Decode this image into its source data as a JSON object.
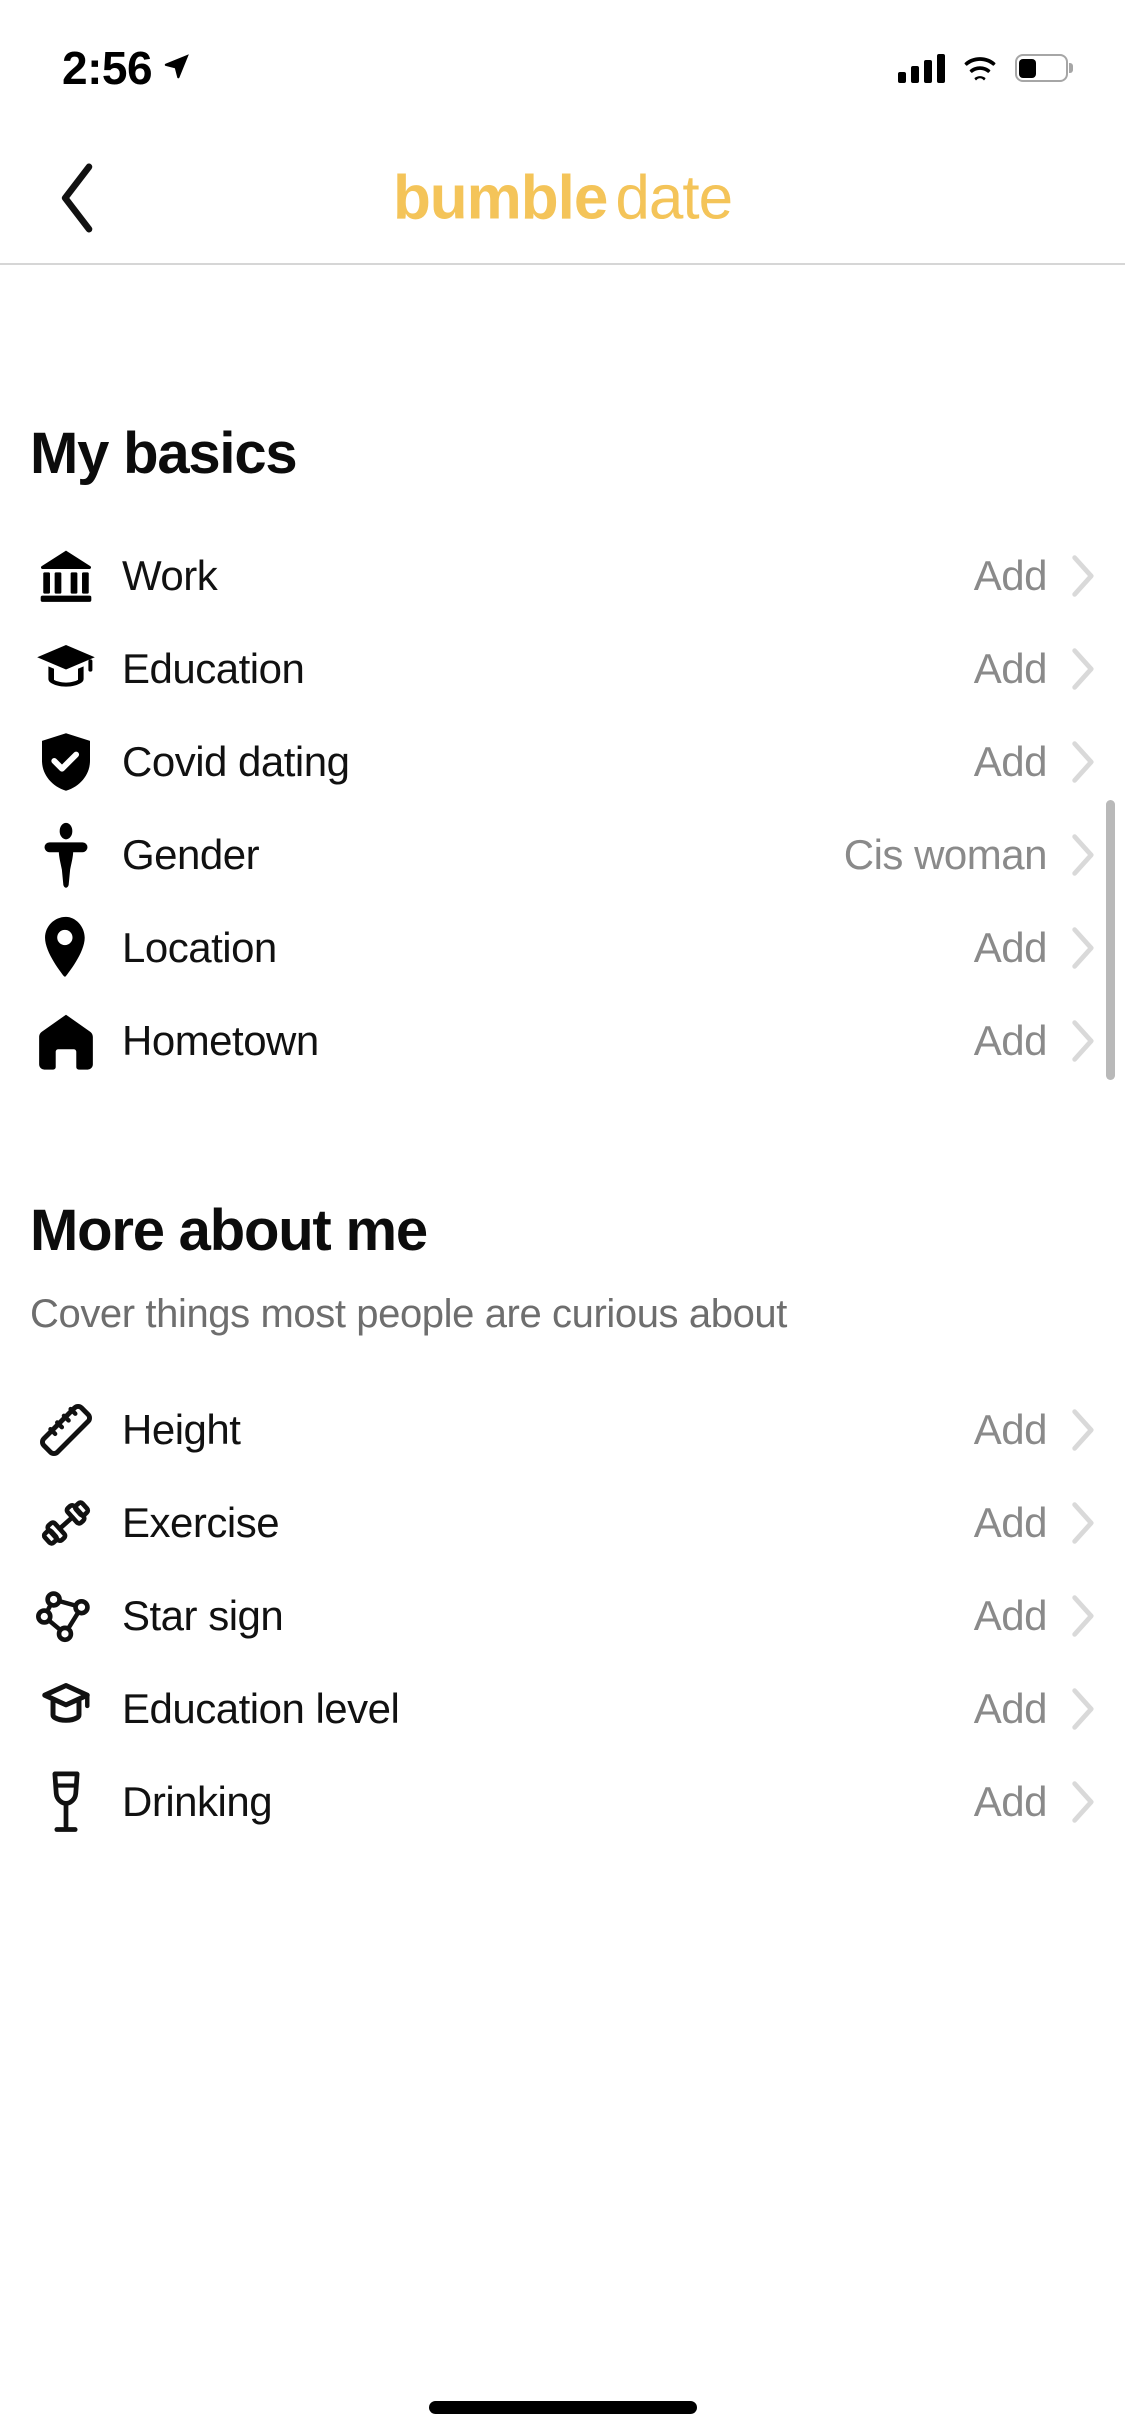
{
  "status_bar": {
    "time": "2:56",
    "location_icon": "location-arrow-icon",
    "cellular_icon": "cellular-signal-icon",
    "cellular_bars": 4,
    "wifi_icon": "wifi-icon",
    "battery_icon": "battery-icon",
    "battery_level_percent": 30
  },
  "navbar": {
    "back_icon": "chevron-left-icon",
    "brand_primary": "bumble",
    "brand_secondary": "date",
    "brand_color": "#F4C459"
  },
  "sections": [
    {
      "title": "My basics",
      "subtitle": "",
      "rows": [
        {
          "icon": "bank-icon",
          "label": "Work",
          "value": "Add",
          "chevron": "chevron-right-icon"
        },
        {
          "icon": "graduation-cap-filled-icon",
          "label": "Education",
          "value": "Add",
          "chevron": "chevron-right-icon"
        },
        {
          "icon": "shield-check-icon",
          "label": "Covid dating",
          "value": "Add",
          "chevron": "chevron-right-icon"
        },
        {
          "icon": "person-icon",
          "label": "Gender",
          "value": "Cis woman",
          "chevron": "chevron-right-icon"
        },
        {
          "icon": "map-pin-icon",
          "label": "Location",
          "value": "Add",
          "chevron": "chevron-right-icon"
        },
        {
          "icon": "house-icon",
          "label": "Hometown",
          "value": "Add",
          "chevron": "chevron-right-icon"
        }
      ]
    },
    {
      "title": "More about me",
      "subtitle": "Cover things most people are curious about",
      "rows": [
        {
          "icon": "ruler-icon",
          "label": "Height",
          "value": "Add",
          "chevron": "chevron-right-icon"
        },
        {
          "icon": "dumbbell-icon",
          "label": "Exercise",
          "value": "Add",
          "chevron": "chevron-right-icon"
        },
        {
          "icon": "constellation-icon",
          "label": "Star sign",
          "value": "Add",
          "chevron": "chevron-right-icon"
        },
        {
          "icon": "graduation-cap-outline-icon",
          "label": "Education level",
          "value": "Add",
          "chevron": "chevron-right-icon"
        },
        {
          "icon": "wine-glass-icon",
          "label": "Drinking",
          "value": "Add",
          "chevron": "chevron-right-icon"
        }
      ]
    }
  ],
  "colors": {
    "brand_yellow": "#F4C459",
    "value_gray": "#8a8a8a",
    "subtitle_gray": "#6e6e6e",
    "chevron_gray": "#d9d9d9"
  }
}
